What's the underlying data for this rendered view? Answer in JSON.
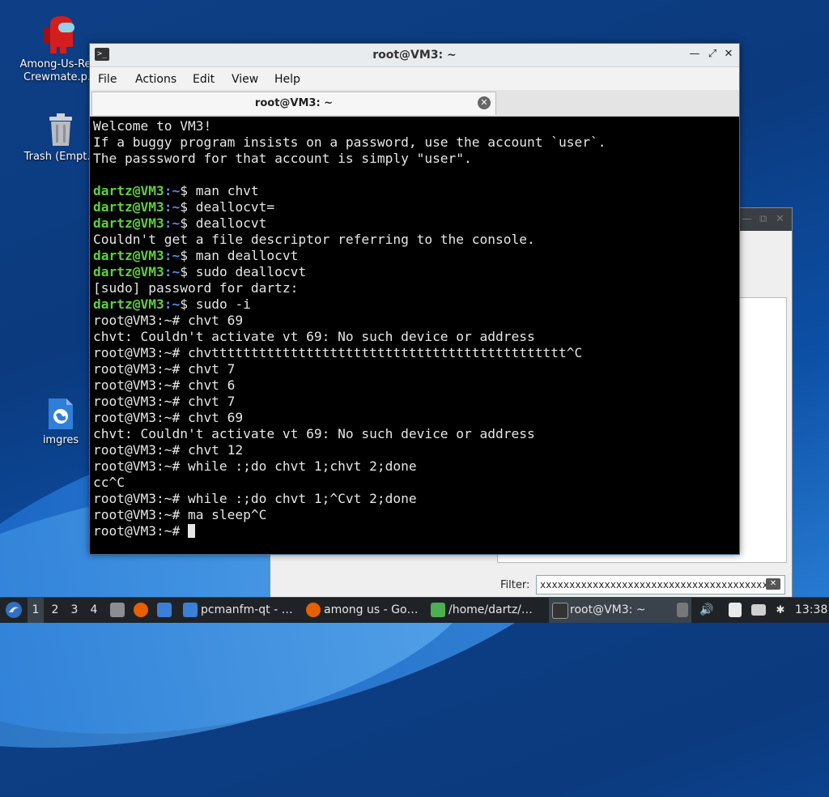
{
  "desktop": {
    "icons": [
      {
        "label": "Among-Us-Re…",
        "label2": "Crewmate.p…"
      },
      {
        "label": "Trash (Empt…"
      },
      {
        "label": "imgres"
      }
    ]
  },
  "terminal": {
    "title": "root@VM3: ~",
    "menu": [
      "File",
      "Actions",
      "Edit",
      "View",
      "Help"
    ],
    "tab_label": "root@VM3: ~",
    "lines": [
      {
        "t": "Welcome to VM3!"
      },
      {
        "t": "If a buggy program insists on a password, use the account `user`."
      },
      {
        "t": "The passsword for that account is simply \"user\"."
      },
      {
        "t": ""
      },
      {
        "user": "dartz@VM3",
        "path": ":~",
        "cmd": "$ man chvt"
      },
      {
        "user": "dartz@VM3",
        "path": ":~",
        "cmd": "$ deallocvt="
      },
      {
        "user": "dartz@VM3",
        "path": ":~",
        "cmd": "$ deallocvt"
      },
      {
        "t": "Couldn't get a file descriptor referring to the console."
      },
      {
        "user": "dartz@VM3",
        "path": ":~",
        "cmd": "$ man deallocvt"
      },
      {
        "user": "dartz@VM3",
        "path": ":~",
        "cmd": "$ sudo deallocvt"
      },
      {
        "t": "[sudo] password for dartz:"
      },
      {
        "user": "dartz@VM3",
        "path": ":~",
        "cmd": "$ sudo -i"
      },
      {
        "t": "root@VM3:~# chvt 69"
      },
      {
        "t": "chvt: Couldn't activate vt 69: No such device or address"
      },
      {
        "t": "root@VM3:~# chvttttttttttttttttttttttttttttttttttttttttttttt^C"
      },
      {
        "t": "root@VM3:~# chvt 7"
      },
      {
        "t": "root@VM3:~# chvt 6"
      },
      {
        "t": "root@VM3:~# chvt 7"
      },
      {
        "t": "root@VM3:~# chvt 69"
      },
      {
        "t": "chvt: Couldn't activate vt 69: No such device or address"
      },
      {
        "t": "root@VM3:~# chvt 12"
      },
      {
        "t": "root@VM3:~# while :;do chvt 1;chvt 2;done"
      },
      {
        "t": "cc^C"
      },
      {
        "t": "root@VM3:~# while :;do chvt 1;^Cvt 2;done"
      },
      {
        "t": "root@VM3:~# ma sleep^C"
      },
      {
        "t": "root@VM3:~# ",
        "cursor": true
      }
    ]
  },
  "background_window": {
    "filter_label": "Filter:",
    "filter_value": "xxxxxxxxxxxxxxxxxxxxxxxxxxxxxxxxxxxxxxx"
  },
  "taskbar": {
    "workspaces": [
      "1",
      "2",
      "3",
      "4"
    ],
    "tasks": [
      {
        "label": "pcmanfm-qt - …",
        "icon": "folder-icon",
        "color": "#3b7fd6"
      },
      {
        "label": "among us - Go…",
        "icon": "firefox-icon",
        "color": "#e66000"
      },
      {
        "label": "/home/dartz/…",
        "icon": "image-viewer-icon",
        "color": "#4caf50"
      },
      {
        "label": "root@VM3: ~",
        "icon": "terminal-icon",
        "color": "#333333"
      }
    ],
    "clock": "13:38"
  },
  "colors": {
    "prompt_user": "#5fd13a",
    "prompt_path": "#4f8fe6",
    "terminal_bg": "#000000",
    "taskbar_bg": "#1f2327"
  }
}
